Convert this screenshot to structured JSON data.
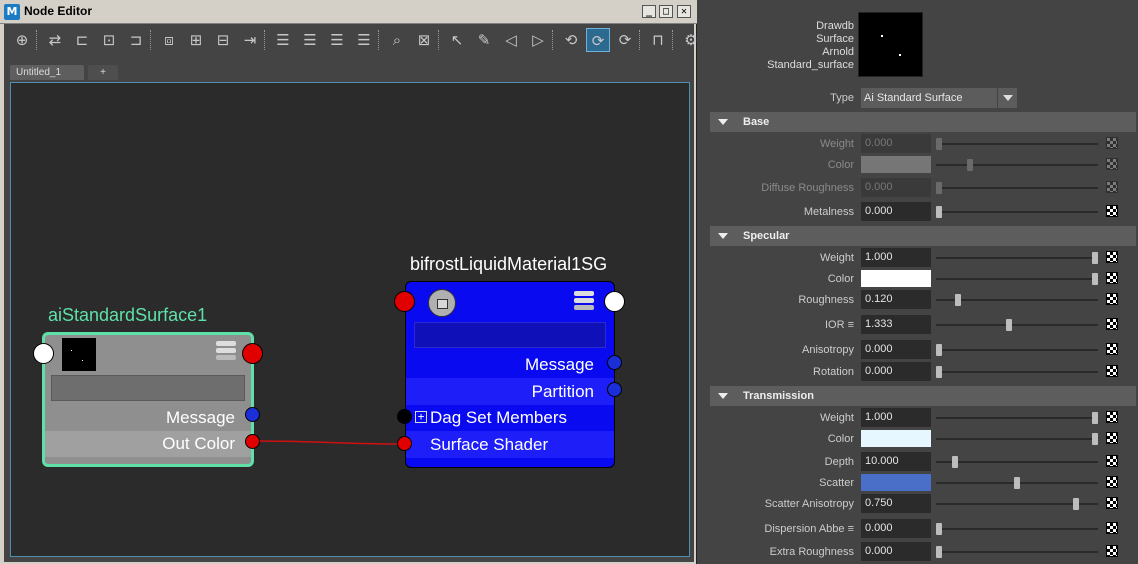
{
  "window": {
    "title": "Node Editor",
    "app_icon": "M",
    "btn_min": "_",
    "btn_max": "□",
    "btn_close": "✕"
  },
  "toolbar": {
    "icons": [
      "graph-add-icon",
      "swap-icon",
      "frame-in-icon",
      "frame-both-icon",
      "frame-out-icon",
      "select-node-icon",
      "add-node-icon",
      "remove-node-icon",
      "pin-icon",
      "layout-simple-icon",
      "layout-connected-icon",
      "layout-full-icon",
      "layout-custom-icon",
      "search-icon",
      "snapshot-icon",
      "pick-walk-icon",
      "edit-icon",
      "step-back-icon",
      "step-forward-icon",
      "graph-upstream-icon",
      "graph-both-icon",
      "graph-downstream-icon",
      "lock-icon",
      "settings-icon"
    ],
    "active_index": 20
  },
  "tabs": [
    {
      "label": "Untitled_1"
    },
    {
      "label": "+"
    }
  ],
  "nodes": {
    "ai": {
      "title": "aiStandardSurface1",
      "title_color": "#5fe0a8",
      "ports": [
        "Message",
        "Out Color"
      ]
    },
    "sg": {
      "title": "bifrostLiquidMaterial1SG",
      "title_color": "#ffffff",
      "ports_right": [
        "Message",
        "Partition"
      ],
      "ports_left": [
        "Dag Set Members",
        "Surface Shader"
      ],
      "expand": "+"
    },
    "connection_color": "#d01010"
  },
  "attr": {
    "swatch_labels": [
      "Drawdb",
      "Surface",
      "Arnold",
      "Standard_surface"
    ],
    "type_label": "Type",
    "type_value": "Ai Standard Surface",
    "sections": {
      "base": "Base",
      "specular": "Specular",
      "transmission": "Transmission"
    },
    "base": [
      {
        "label": "Weight",
        "value": "0.000",
        "dim": true,
        "slider": 0.0
      },
      {
        "label": "Color",
        "color": "#7f7f7f",
        "dim": true,
        "slider": 0.2
      },
      {
        "label": "Diffuse Roughness",
        "value": "0.000",
        "dim": true,
        "slider": 0.0
      },
      {
        "label": "Metalness",
        "value": "0.000",
        "dim": false,
        "slider": 0.0
      }
    ],
    "specular": [
      {
        "label": "Weight",
        "value": "1.000",
        "slider": 1.0
      },
      {
        "label": "Color",
        "color": "#ffffff",
        "slider": 1.0
      },
      {
        "label": "Roughness",
        "value": "0.120",
        "slider": 0.12
      },
      {
        "label": "IOR ≡",
        "value": "1.333",
        "slider": 0.45
      },
      {
        "label": "Anisotropy",
        "value": "0.000",
        "slider": 0.0
      },
      {
        "label": "Rotation",
        "value": "0.000",
        "slider": 0.0
      }
    ],
    "transmission": [
      {
        "label": "Weight",
        "value": "1.000",
        "slider": 1.0
      },
      {
        "label": "Color",
        "color": "#e6f7ff",
        "slider": 1.0
      },
      {
        "label": "Depth",
        "value": "10.000",
        "slider": 0.1
      },
      {
        "label": "Scatter",
        "color": "#4a6fc8",
        "slider": 0.5
      },
      {
        "label": "Scatter Anisotropy",
        "value": "0.750",
        "slider": 0.88
      },
      {
        "label": "Dispersion Abbe ≡",
        "value": "0.000",
        "slider": 0.0
      },
      {
        "label": "Extra Roughness",
        "value": "0.000",
        "slider": 0.0
      }
    ]
  }
}
